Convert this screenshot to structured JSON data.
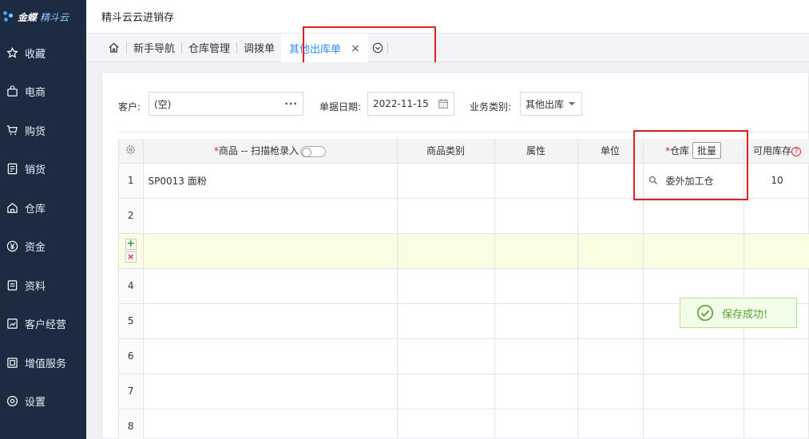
{
  "brand": {
    "name_a": "金蝶",
    "name_b": "精斗云"
  },
  "sidebar": {
    "items": [
      {
        "label": "收藏",
        "icon": "star-icon"
      },
      {
        "label": "电商",
        "icon": "bag-icon"
      },
      {
        "label": "购货",
        "icon": "cart-icon"
      },
      {
        "label": "销货",
        "icon": "receipt-icon"
      },
      {
        "label": "仓库",
        "icon": "warehouse-icon"
      },
      {
        "label": "资金",
        "icon": "yen-icon"
      },
      {
        "label": "资料",
        "icon": "document-icon"
      },
      {
        "label": "客户经营",
        "icon": "chart-icon"
      },
      {
        "label": "增值服务",
        "icon": "value-service-icon"
      },
      {
        "label": "设置",
        "icon": "gear-icon"
      }
    ]
  },
  "header": {
    "title": "精斗云云进销存"
  },
  "tabs": {
    "items": [
      "新手导航",
      "仓库管理",
      "调拨单"
    ],
    "active": "其他出库单",
    "close_glyph": "×"
  },
  "form": {
    "customer_label": "客户:",
    "customer_value": "(空)",
    "customer_more": "···",
    "date_label": "单据日期:",
    "date_value": "2022-11-15",
    "biz_type_label": "业务类别:",
    "biz_type_value": "其他出库"
  },
  "grid": {
    "headers": {
      "product_req": "*",
      "product": "商品 -- 扫描枪录入",
      "category": "商品类别",
      "attribute": "属性",
      "unit": "单位",
      "warehouse_req": "*",
      "warehouse": "仓库",
      "batch": "批量",
      "stock": "可用库存",
      "stock_help": "?"
    },
    "rows": [
      {
        "num": "1",
        "product": "SP0013 面粉",
        "warehouse": "委外加工仓",
        "stock": "10"
      },
      {
        "num": "2",
        "product": "",
        "warehouse": "",
        "stock": ""
      },
      {
        "num": "",
        "product": "",
        "warehouse": "",
        "stock": ""
      },
      {
        "num": "4",
        "product": "",
        "warehouse": "",
        "stock": ""
      },
      {
        "num": "5",
        "product": "",
        "warehouse": "",
        "stock": ""
      },
      {
        "num": "6",
        "product": "",
        "warehouse": "",
        "stock": ""
      },
      {
        "num": "7",
        "product": "",
        "warehouse": "",
        "stock": ""
      },
      {
        "num": "8",
        "product": "",
        "warehouse": "",
        "stock": ""
      }
    ],
    "add_glyph": "+",
    "delete_glyph": "×"
  },
  "toast": {
    "message": "保存成功!"
  },
  "colors": {
    "sidebar": "#1c2b41",
    "accent": "#2f8cff",
    "highlight": "#e02020",
    "success": "#57a630"
  }
}
